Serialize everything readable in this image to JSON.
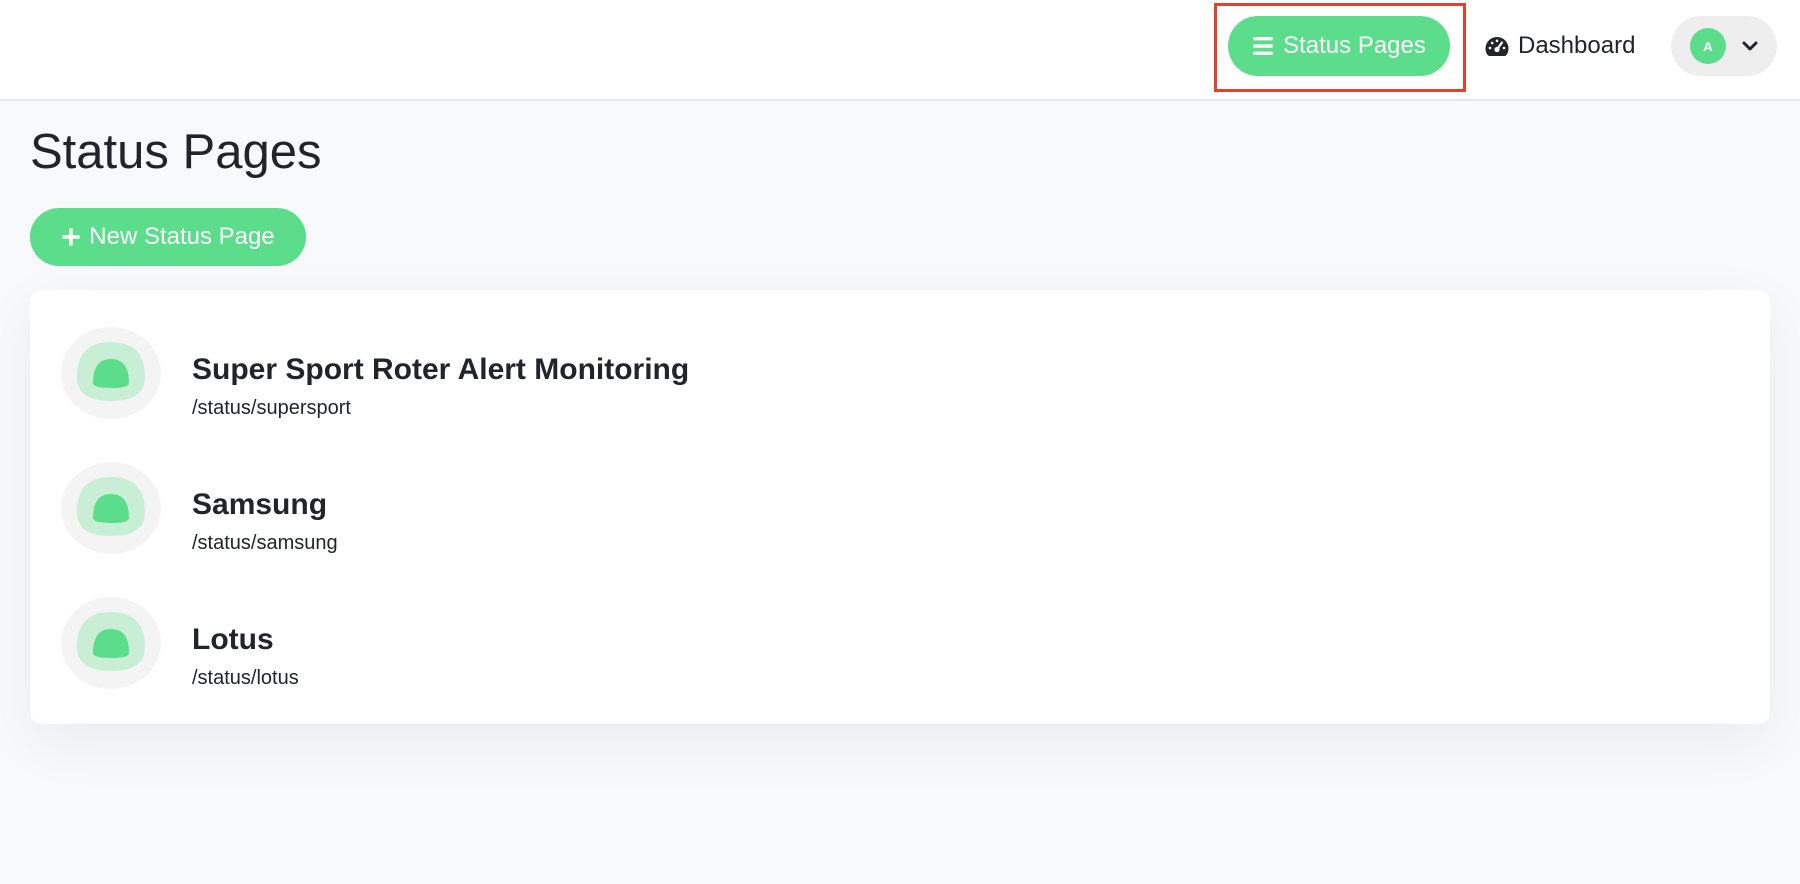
{
  "nav": {
    "status_pages_label": "Status Pages",
    "dashboard_label": "Dashboard",
    "avatar_initial": "A"
  },
  "page": {
    "title": "Status Pages",
    "new_button_label": "New Status Page"
  },
  "status_pages": [
    {
      "name": "Super Sport Roter Alert Monitoring",
      "slug": "/status/supersport"
    },
    {
      "name": "Samsung",
      "slug": "/status/samsung"
    },
    {
      "name": "Lotus",
      "slug": "/status/lotus"
    }
  ],
  "colors": {
    "accent": "#5cdd8b",
    "highlight_border": "#e0442f",
    "text": "#212529"
  },
  "icons": {
    "status_pages": "bars-icon",
    "dashboard": "gauge-icon",
    "profile_menu": "chevron-down-icon",
    "new_button": "plus-icon",
    "status_page_logo": "status-logo-icon"
  }
}
